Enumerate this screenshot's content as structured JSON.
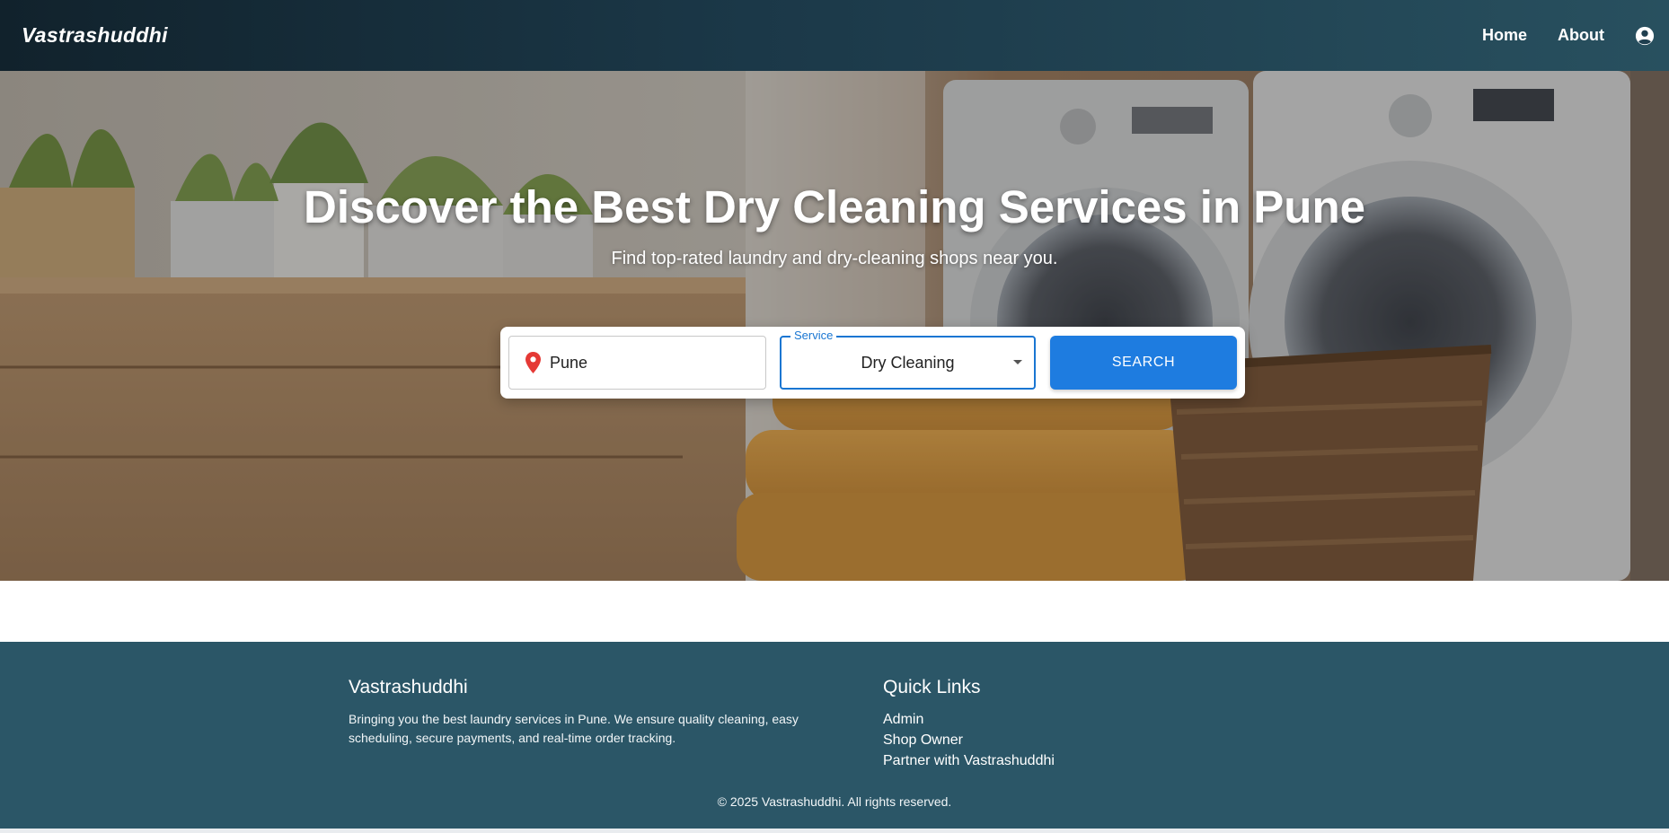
{
  "navbar": {
    "brand": "Vastrashuddhi",
    "links": [
      {
        "label": "Home"
      },
      {
        "label": "About"
      }
    ],
    "account_icon": "account-circle-icon"
  },
  "hero": {
    "title": "Discover the Best Dry Cleaning Services in Pune",
    "subtitle": "Find top-rated laundry and dry-cleaning shops near you.",
    "background": "laundry room photo with washing machines, folded towels and basket"
  },
  "search": {
    "location_value": "Pune",
    "location_icon": "map-pin-icon",
    "pin_color": "#e53935",
    "service_label": "Service",
    "service_value": "Dry Cleaning",
    "button_label": "SEARCH",
    "accent_color": "#1e7ce0"
  },
  "footer": {
    "brand_heading": "Vastrashuddhi",
    "brand_text": "Bringing you the best laundry services in Pune. We ensure quality cleaning, easy scheduling, secure payments, and real-time order tracking.",
    "links_heading": "Quick Links",
    "links": [
      {
        "label": "Admin"
      },
      {
        "label": "Shop Owner"
      },
      {
        "label": "Partner with Vastrashuddhi"
      }
    ],
    "copyright": "© 2025 Vastrashuddhi. All rights reserved.",
    "background_color": "#2b5667"
  }
}
